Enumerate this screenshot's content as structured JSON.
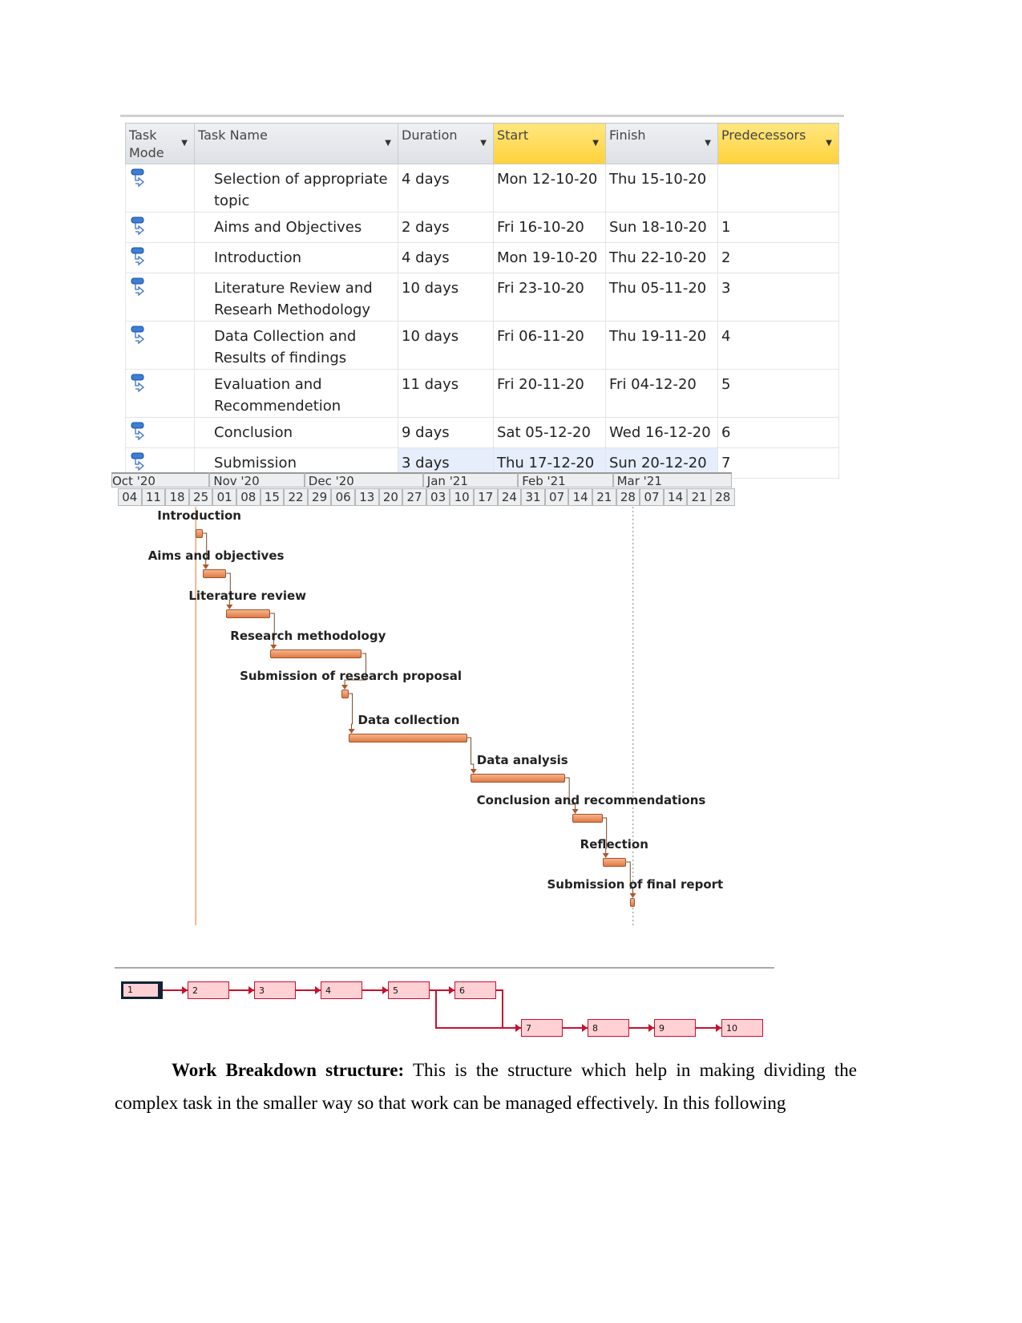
{
  "table": {
    "headers": [
      "Task Mode",
      "Task Name",
      "Duration",
      "Start",
      "Finish",
      "Predecessors"
    ],
    "highlighted_headers": [
      "Start",
      "Predecessors"
    ],
    "rows": [
      {
        "name": "Selection of appropriate topic",
        "duration": "4 days",
        "start": "Mon 12-10-20",
        "finish": "Thu 15-10-20",
        "pred": ""
      },
      {
        "name": "Aims and Objectives",
        "duration": "2 days",
        "start": "Fri 16-10-20",
        "finish": "Sun 18-10-20",
        "pred": "1"
      },
      {
        "name": "Introduction",
        "duration": "4 days",
        "start": "Mon 19-10-20",
        "finish": "Thu 22-10-20",
        "pred": "2"
      },
      {
        "name": "Literature Review and Researh Methodology",
        "duration": "10 days",
        "start": "Fri 23-10-20",
        "finish": "Thu 05-11-20",
        "pred": "3"
      },
      {
        "name": "Data Collection and Results of findings",
        "duration": "10 days",
        "start": "Fri 06-11-20",
        "finish": "Thu 19-11-20",
        "pred": "4"
      },
      {
        "name": "Evaluation and Recommendetion",
        "duration": "11 days",
        "start": "Fri 20-11-20",
        "finish": "Fri 04-12-20",
        "pred": "5"
      },
      {
        "name": "Conclusion",
        "duration": "9 days",
        "start": "Sat 05-12-20",
        "finish": "Wed 16-12-20",
        "pred": "6"
      },
      {
        "name": "Submission",
        "duration": "3 days",
        "start": "Thu 17-12-20",
        "finish": "Sun 20-12-20",
        "pred": "7"
      }
    ],
    "task_mode_icon": "auto-scheduled-task-icon",
    "header_highlight_color": "#ffd84a"
  },
  "gantt": {
    "months": [
      "Oct '20",
      "Nov '20",
      "Dec '20",
      "Jan '21",
      "Feb '21",
      "Mar '21"
    ],
    "weeks": [
      "04",
      "11",
      "18",
      "25",
      "01",
      "08",
      "15",
      "22",
      "29",
      "06",
      "13",
      "20",
      "27",
      "03",
      "10",
      "17",
      "24",
      "31",
      "07",
      "14",
      "21",
      "28",
      "07",
      "14",
      "21",
      "28"
    ],
    "today_line": "2020-10-27",
    "status_line": "2021-03-05",
    "bar_color": "#e8905e",
    "tasks": [
      {
        "label": "Introduction",
        "start": "2020-10-27",
        "end": "2020-10-29"
      },
      {
        "label": "Aims and objectives",
        "start": "2020-10-29",
        "end": "2020-11-05"
      },
      {
        "label": "Literature review",
        "start": "2020-11-05",
        "end": "2020-11-18"
      },
      {
        "label": "Research methodology",
        "start": "2020-11-18",
        "end": "2020-12-15"
      },
      {
        "label": "Submission of research proposal",
        "start": "2020-12-09",
        "end": "2020-12-11"
      },
      {
        "label": "Data collection",
        "start": "2020-12-11",
        "end": "2021-01-15"
      },
      {
        "label": "Data analysis",
        "start": "2021-01-16",
        "end": "2021-02-13"
      },
      {
        "label": "Conclusion and recommendations",
        "start": "2021-02-15",
        "end": "2021-02-24"
      },
      {
        "label": "Reflection",
        "start": "2021-02-24",
        "end": "2021-03-03"
      },
      {
        "label": "Submission of final report",
        "start": "2021-03-04",
        "end": "2021-03-05"
      }
    ]
  },
  "network": {
    "nodes": [
      "1",
      "2",
      "3",
      "4",
      "5",
      "6",
      "7",
      "8",
      "9",
      "10"
    ],
    "color": "#c8102e"
  },
  "paragraph": {
    "bold": "Work Breakdown structure:",
    "text": " This is the structure which help in making dividing the complex task in the smaller way so that work can be managed effectively. In this following"
  }
}
